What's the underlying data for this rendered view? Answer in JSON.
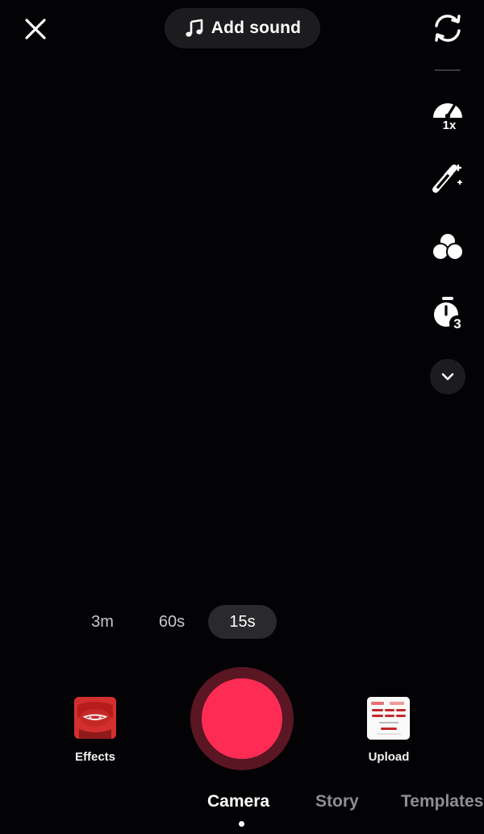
{
  "top_bar": {
    "sound_label": "Add sound"
  },
  "side_tools": {
    "speed_badge": "1x",
    "timer_badge": "3"
  },
  "durations": [
    "3m",
    "60s",
    "15s"
  ],
  "selected_duration": "15s",
  "effects": {
    "label": "Effects"
  },
  "upload": {
    "label": "Upload"
  },
  "modes": [
    "Camera",
    "Story",
    "Templates"
  ],
  "selected_mode": "Camera",
  "colors": {
    "record": "#fe2c55",
    "background": "#000000"
  }
}
